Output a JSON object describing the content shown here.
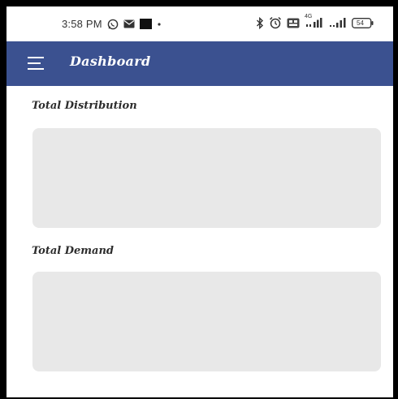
{
  "status_bar": {
    "time": "3:58 PM",
    "battery": "54",
    "network": "4G",
    "left_icons": [
      "whatsapp-icon",
      "message-icon",
      "square-icon",
      "dot-icon"
    ],
    "right_icons": [
      "bluetooth-icon",
      "alarm-icon",
      "volte-icon",
      "signal-icon",
      "signal-icon",
      "battery-icon"
    ]
  },
  "app_bar": {
    "title": "Dashboard",
    "background": "#3b5190",
    "menu_icon": "hamburger-menu-icon"
  },
  "sections": [
    {
      "title": "Total Distribution"
    },
    {
      "title": "Total Demand"
    }
  ],
  "colors": {
    "card_background": "#e8e8e8",
    "title_text": "#2d2d2d"
  }
}
